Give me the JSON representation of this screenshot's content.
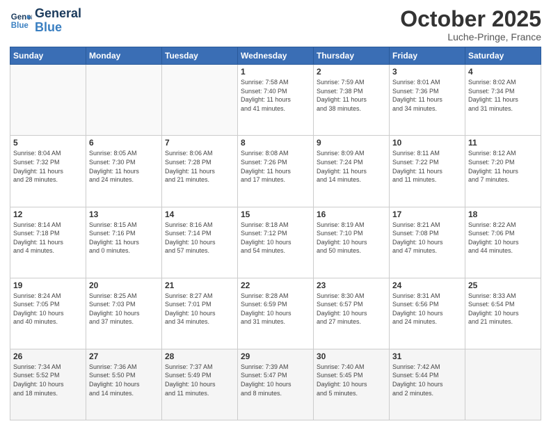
{
  "logo": {
    "line1": "General",
    "line2": "Blue"
  },
  "title": "October 2025",
  "subtitle": "Luche-Pringe, France",
  "days_header": [
    "Sunday",
    "Monday",
    "Tuesday",
    "Wednesday",
    "Thursday",
    "Friday",
    "Saturday"
  ],
  "weeks": [
    [
      {
        "day": "",
        "info": ""
      },
      {
        "day": "",
        "info": ""
      },
      {
        "day": "",
        "info": ""
      },
      {
        "day": "1",
        "info": "Sunrise: 7:58 AM\nSunset: 7:40 PM\nDaylight: 11 hours\nand 41 minutes."
      },
      {
        "day": "2",
        "info": "Sunrise: 7:59 AM\nSunset: 7:38 PM\nDaylight: 11 hours\nand 38 minutes."
      },
      {
        "day": "3",
        "info": "Sunrise: 8:01 AM\nSunset: 7:36 PM\nDaylight: 11 hours\nand 34 minutes."
      },
      {
        "day": "4",
        "info": "Sunrise: 8:02 AM\nSunset: 7:34 PM\nDaylight: 11 hours\nand 31 minutes."
      }
    ],
    [
      {
        "day": "5",
        "info": "Sunrise: 8:04 AM\nSunset: 7:32 PM\nDaylight: 11 hours\nand 28 minutes."
      },
      {
        "day": "6",
        "info": "Sunrise: 8:05 AM\nSunset: 7:30 PM\nDaylight: 11 hours\nand 24 minutes."
      },
      {
        "day": "7",
        "info": "Sunrise: 8:06 AM\nSunset: 7:28 PM\nDaylight: 11 hours\nand 21 minutes."
      },
      {
        "day": "8",
        "info": "Sunrise: 8:08 AM\nSunset: 7:26 PM\nDaylight: 11 hours\nand 17 minutes."
      },
      {
        "day": "9",
        "info": "Sunrise: 8:09 AM\nSunset: 7:24 PM\nDaylight: 11 hours\nand 14 minutes."
      },
      {
        "day": "10",
        "info": "Sunrise: 8:11 AM\nSunset: 7:22 PM\nDaylight: 11 hours\nand 11 minutes."
      },
      {
        "day": "11",
        "info": "Sunrise: 8:12 AM\nSunset: 7:20 PM\nDaylight: 11 hours\nand 7 minutes."
      }
    ],
    [
      {
        "day": "12",
        "info": "Sunrise: 8:14 AM\nSunset: 7:18 PM\nDaylight: 11 hours\nand 4 minutes."
      },
      {
        "day": "13",
        "info": "Sunrise: 8:15 AM\nSunset: 7:16 PM\nDaylight: 11 hours\nand 0 minutes."
      },
      {
        "day": "14",
        "info": "Sunrise: 8:16 AM\nSunset: 7:14 PM\nDaylight: 10 hours\nand 57 minutes."
      },
      {
        "day": "15",
        "info": "Sunrise: 8:18 AM\nSunset: 7:12 PM\nDaylight: 10 hours\nand 54 minutes."
      },
      {
        "day": "16",
        "info": "Sunrise: 8:19 AM\nSunset: 7:10 PM\nDaylight: 10 hours\nand 50 minutes."
      },
      {
        "day": "17",
        "info": "Sunrise: 8:21 AM\nSunset: 7:08 PM\nDaylight: 10 hours\nand 47 minutes."
      },
      {
        "day": "18",
        "info": "Sunrise: 8:22 AM\nSunset: 7:06 PM\nDaylight: 10 hours\nand 44 minutes."
      }
    ],
    [
      {
        "day": "19",
        "info": "Sunrise: 8:24 AM\nSunset: 7:05 PM\nDaylight: 10 hours\nand 40 minutes."
      },
      {
        "day": "20",
        "info": "Sunrise: 8:25 AM\nSunset: 7:03 PM\nDaylight: 10 hours\nand 37 minutes."
      },
      {
        "day": "21",
        "info": "Sunrise: 8:27 AM\nSunset: 7:01 PM\nDaylight: 10 hours\nand 34 minutes."
      },
      {
        "day": "22",
        "info": "Sunrise: 8:28 AM\nSunset: 6:59 PM\nDaylight: 10 hours\nand 31 minutes."
      },
      {
        "day": "23",
        "info": "Sunrise: 8:30 AM\nSunset: 6:57 PM\nDaylight: 10 hours\nand 27 minutes."
      },
      {
        "day": "24",
        "info": "Sunrise: 8:31 AM\nSunset: 6:56 PM\nDaylight: 10 hours\nand 24 minutes."
      },
      {
        "day": "25",
        "info": "Sunrise: 8:33 AM\nSunset: 6:54 PM\nDaylight: 10 hours\nand 21 minutes."
      }
    ],
    [
      {
        "day": "26",
        "info": "Sunrise: 7:34 AM\nSunset: 5:52 PM\nDaylight: 10 hours\nand 18 minutes."
      },
      {
        "day": "27",
        "info": "Sunrise: 7:36 AM\nSunset: 5:50 PM\nDaylight: 10 hours\nand 14 minutes."
      },
      {
        "day": "28",
        "info": "Sunrise: 7:37 AM\nSunset: 5:49 PM\nDaylight: 10 hours\nand 11 minutes."
      },
      {
        "day": "29",
        "info": "Sunrise: 7:39 AM\nSunset: 5:47 PM\nDaylight: 10 hours\nand 8 minutes."
      },
      {
        "day": "30",
        "info": "Sunrise: 7:40 AM\nSunset: 5:45 PM\nDaylight: 10 hours\nand 5 minutes."
      },
      {
        "day": "31",
        "info": "Sunrise: 7:42 AM\nSunset: 5:44 PM\nDaylight: 10 hours\nand 2 minutes."
      },
      {
        "day": "",
        "info": ""
      }
    ]
  ]
}
